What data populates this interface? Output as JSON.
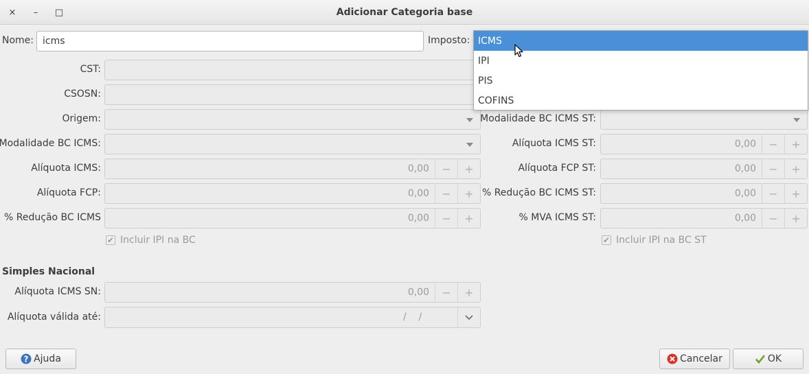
{
  "window": {
    "title": "Adicionar Categoria base",
    "close_glyph": "×",
    "minimize_glyph": "–",
    "maximize_glyph": "□"
  },
  "form": {
    "nome_label": "Nome:",
    "nome_value": "icms",
    "imposto_label": "Imposto:",
    "cst_label": "CST:",
    "csosn_label": "CSOSN:",
    "origem_label": "Origem:",
    "modalidade_bc_icms_label": "Modalidade BC ICMS:",
    "aliquota_icms_label": "Alíquota ICMS:",
    "aliquota_icms_value": "0,00",
    "aliquota_fcp_label": "Alíquota FCP:",
    "aliquota_fcp_value": "0,00",
    "reducao_bc_icms_label": "% Redução BC ICMS",
    "reducao_bc_icms_value": "0,00",
    "incluir_ipi_bc_label": "Incluir IPI na BC",
    "modalidade_bc_icms_st_label": "Modalidade BC ICMS ST:",
    "aliquota_icms_st_label": "Alíquota ICMS ST:",
    "aliquota_icms_st_value": "0,00",
    "aliquota_fcp_st_label": "Alíquota FCP ST:",
    "aliquota_fcp_st_value": "0,00",
    "reducao_bc_icms_st_label": "% Redução BC ICMS ST:",
    "reducao_bc_icms_st_value": "0,00",
    "mva_icms_st_label": "% MVA ICMS ST:",
    "mva_icms_st_value": "0,00",
    "incluir_ipi_bc_st_label": "Incluir IPI na BC ST",
    "spin_minus": "−",
    "spin_plus": "+"
  },
  "simples": {
    "section_title": "Simples Nacional",
    "aliquota_icms_sn_label": "Alíquota ICMS SN:",
    "aliquota_icms_sn_value": "0,00",
    "aliquota_valida_label": "Alíquota válida até:",
    "aliquota_valida_value": "/    /"
  },
  "imposto_dropdown": {
    "options": [
      "ICMS",
      "IPI",
      "PIS",
      "COFINS"
    ],
    "selected": "ICMS"
  },
  "buttons": {
    "ajuda": "Ajuda",
    "cancelar": "Cancelar",
    "ok": "OK"
  },
  "colors": {
    "selection": "#4a90d9",
    "cancel_icon": "#d9322b",
    "ok_icon": "#6aa121",
    "help_icon": "#3f73b8"
  }
}
